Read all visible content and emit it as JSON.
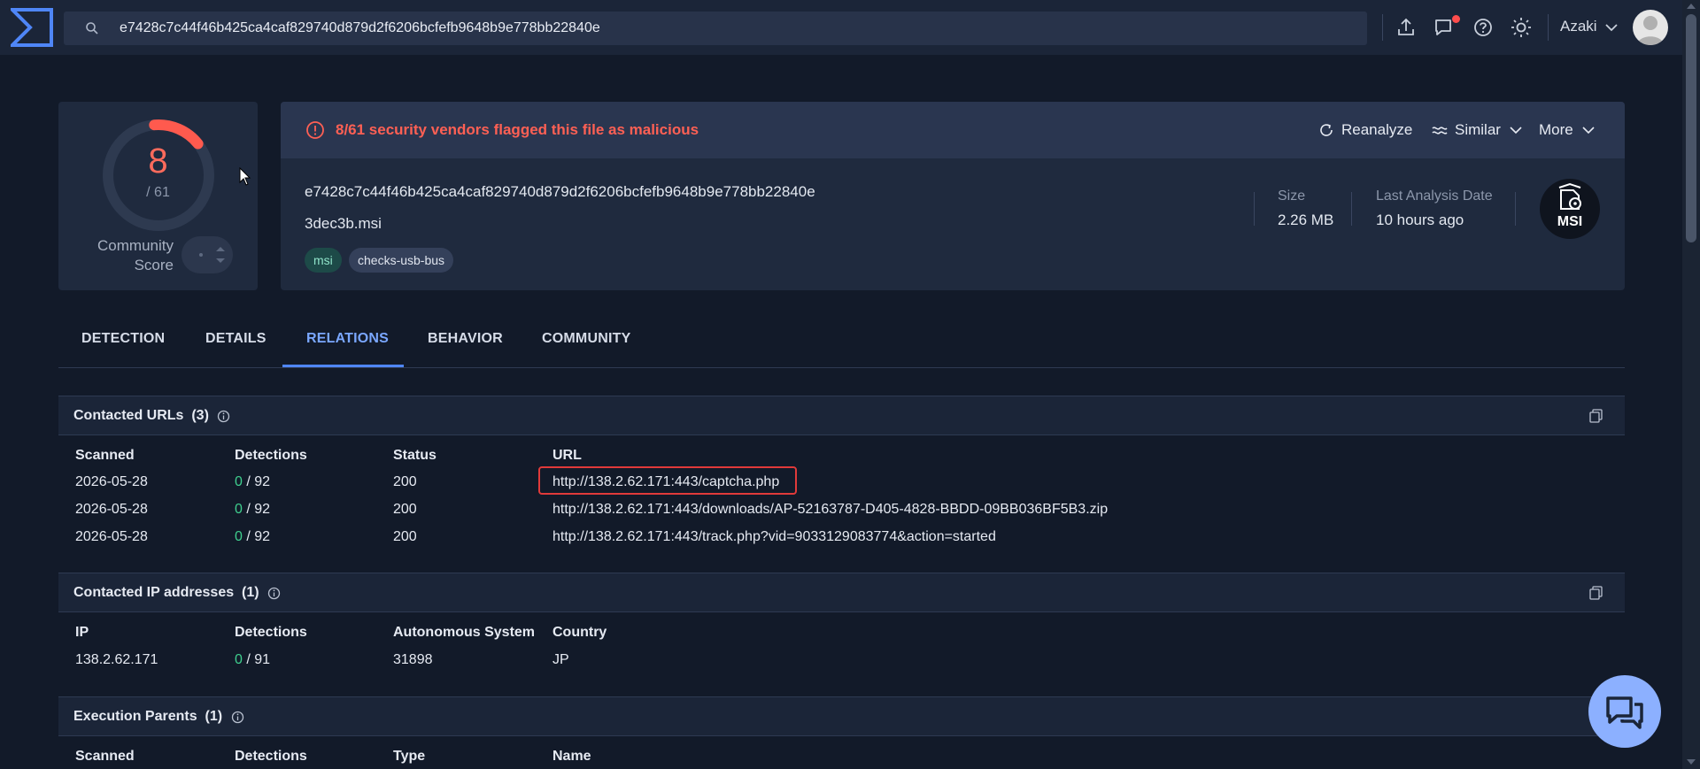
{
  "search": {
    "value": "e7428c7c44f46b425ca4caf829740d879d2f6206bcfefb9648b9e778bb22840e"
  },
  "user": {
    "name": "Azaki"
  },
  "score": {
    "detections": "8",
    "total": "/ 61",
    "community_label_1": "Community",
    "community_label_2": "Score"
  },
  "alert": {
    "text": "8/61 security vendors flagged this file as malicious"
  },
  "actions": {
    "reanalyze": "Reanalyze",
    "similar": "Similar",
    "more": "More"
  },
  "file": {
    "hash": "e7428c7c44f46b425ca4caf829740d879d2f6206bcfefb9648b9e778bb22840e",
    "name": "3dec3b.msi",
    "tags": [
      "msi",
      "checks-usb-bus"
    ],
    "size_label": "Size",
    "size_value": "2.26 MB",
    "date_label": "Last Analysis Date",
    "date_value": "10 hours ago",
    "badge_text": "MSI"
  },
  "tabs": [
    "DETECTION",
    "DETAILS",
    "RELATIONS",
    "BEHAVIOR",
    "COMMUNITY"
  ],
  "active_tab": "RELATIONS",
  "contacted_urls": {
    "title": "Contacted URLs",
    "count": "(3)",
    "columns": [
      "Scanned",
      "Detections",
      "Status",
      "URL"
    ],
    "rows": [
      {
        "scanned": "2026-05-28",
        "det": "0",
        "det_total": " / 92",
        "status": "200",
        "url": "http://138.2.62.171:443/captcha.php"
      },
      {
        "scanned": "2026-05-28",
        "det": "0",
        "det_total": " / 92",
        "status": "200",
        "url": "http://138.2.62.171:443/downloads/AP-52163787-D405-4828-BBDD-09BB036BF5B3.zip"
      },
      {
        "scanned": "2026-05-28",
        "det": "0",
        "det_total": " / 92",
        "status": "200",
        "url": "http://138.2.62.171:443/track.php?vid=9033129083774&action=started"
      }
    ]
  },
  "contacted_ips": {
    "title": "Contacted IP addresses",
    "count": "(1)",
    "columns": [
      "IP",
      "Detections",
      "Autonomous System",
      "Country"
    ],
    "rows": [
      {
        "ip": "138.2.62.171",
        "det": "0",
        "det_total": " / 91",
        "as": "31898",
        "country": "JP"
      }
    ]
  },
  "execution_parents": {
    "title": "Execution Parents",
    "count": "(1)",
    "columns": [
      "Scanned",
      "Detections",
      "Type",
      "Name"
    ]
  },
  "colors": {
    "malicious": "#ff6054",
    "accent": "#4f86f7",
    "clean": "#3fcf8e",
    "highlight": "#e03a3a"
  }
}
